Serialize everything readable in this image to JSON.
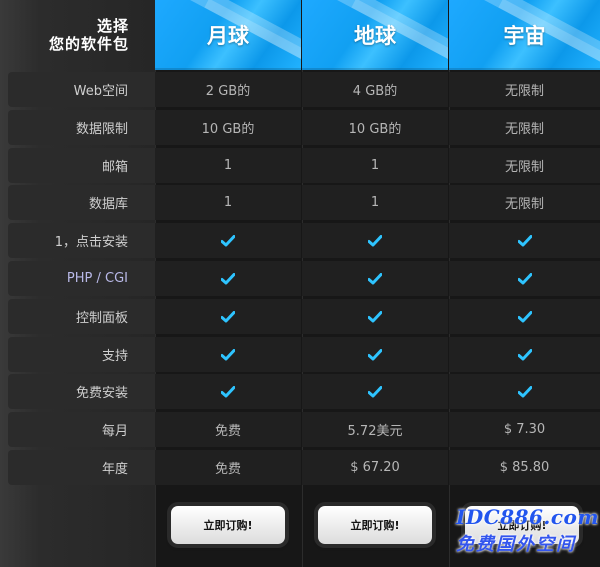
{
  "header": {
    "corner_line1": "选择",
    "corner_line2": "您的软件包",
    "plans": [
      "月球",
      "地球",
      "宇宙"
    ]
  },
  "rows": [
    {
      "label": "Web空间",
      "values": [
        "2 GB的",
        "4 GB的",
        "无限制"
      ]
    },
    {
      "label": "数据限制",
      "values": [
        "10 GB的",
        "10 GB的",
        "无限制"
      ]
    },
    {
      "label": "邮箱",
      "values": [
        "1",
        "1",
        "无限制"
      ]
    },
    {
      "label": "数据库",
      "values": [
        "1",
        "1",
        "无限制"
      ]
    },
    {
      "label": "1，点击安装",
      "values": [
        "check",
        "check",
        "check"
      ]
    },
    {
      "label": "PHP / CGI",
      "values": [
        "check",
        "check",
        "check"
      ]
    },
    {
      "label": "控制面板",
      "values": [
        "check",
        "check",
        "check"
      ]
    },
    {
      "label": "支持",
      "values": [
        "check",
        "check",
        "check"
      ]
    },
    {
      "label": "免费安装",
      "values": [
        "check",
        "check",
        "check"
      ]
    },
    {
      "label": "每月",
      "values": [
        "免费",
        "5.72美元",
        "$ 7.30"
      ]
    },
    {
      "label": "年度",
      "values": [
        "免费",
        "$ 67.20",
        "$ 85.80"
      ]
    }
  ],
  "buttons": {
    "label": "立即订购!"
  },
  "watermark": {
    "logo": "IDC886.com",
    "sub": "免费国外空间"
  },
  "colors": {
    "header_blue": "#1ea9ff",
    "check_blue": "#2ec4ff"
  }
}
